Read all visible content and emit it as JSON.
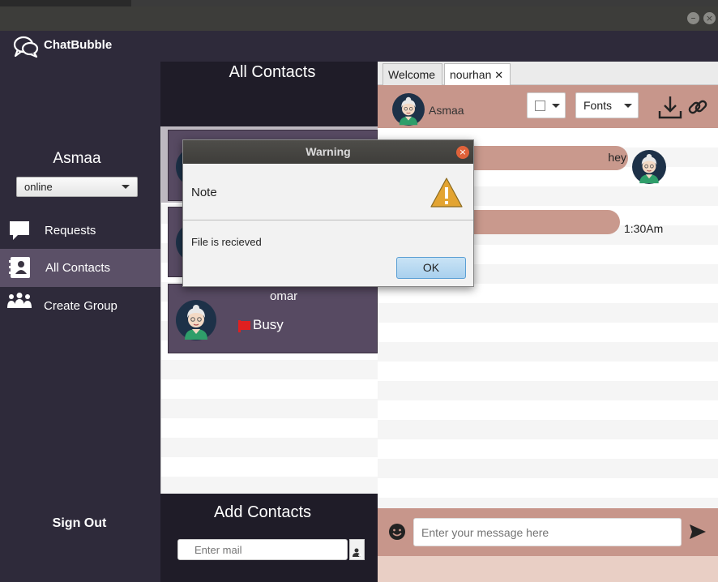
{
  "app": {
    "name": "ChatBubble"
  },
  "sidebar": {
    "user_name": "Asmaa",
    "status": "online",
    "items": [
      {
        "label": "Requests",
        "icon": "speech-bubble-icon",
        "active": false
      },
      {
        "label": "All Contacts",
        "icon": "address-book-icon",
        "active": true
      },
      {
        "label": "Create Group",
        "icon": "group-icon",
        "active": false
      }
    ],
    "sign_out": "Sign Out"
  },
  "contacts": {
    "title": "All Contacts",
    "list": [
      {
        "name": "",
        "status": "",
        "avatar": "avatar-icon"
      },
      {
        "name": "",
        "status": "",
        "avatar": "avatar-icon"
      },
      {
        "name": "omar",
        "status": "Busy",
        "status_color": "#e02020",
        "avatar": "avatar-icon"
      }
    ],
    "add_title": "Add Contacts",
    "mail_placeholder": "Enter mail"
  },
  "chat": {
    "tabs": [
      {
        "label": "Welcome",
        "active": false
      },
      {
        "label": "nourhan",
        "close": "✕",
        "active": true
      }
    ],
    "header": {
      "user": "Asmaa",
      "fonts_label": "Fonts"
    },
    "messages": [
      {
        "text": "hey",
        "side": "right"
      },
      {
        "text": "",
        "time": "1:30Am",
        "side": "left"
      }
    ],
    "input_placeholder": "Enter your message here"
  },
  "dialog": {
    "title": "Warning",
    "header": "Note",
    "message": "File is recieved",
    "ok": "OK"
  },
  "colors": {
    "sidebar_bg": "#2e2a3a",
    "accent": "#c7968b",
    "active_item": "#5b5067",
    "contact_card": "#574a62"
  }
}
